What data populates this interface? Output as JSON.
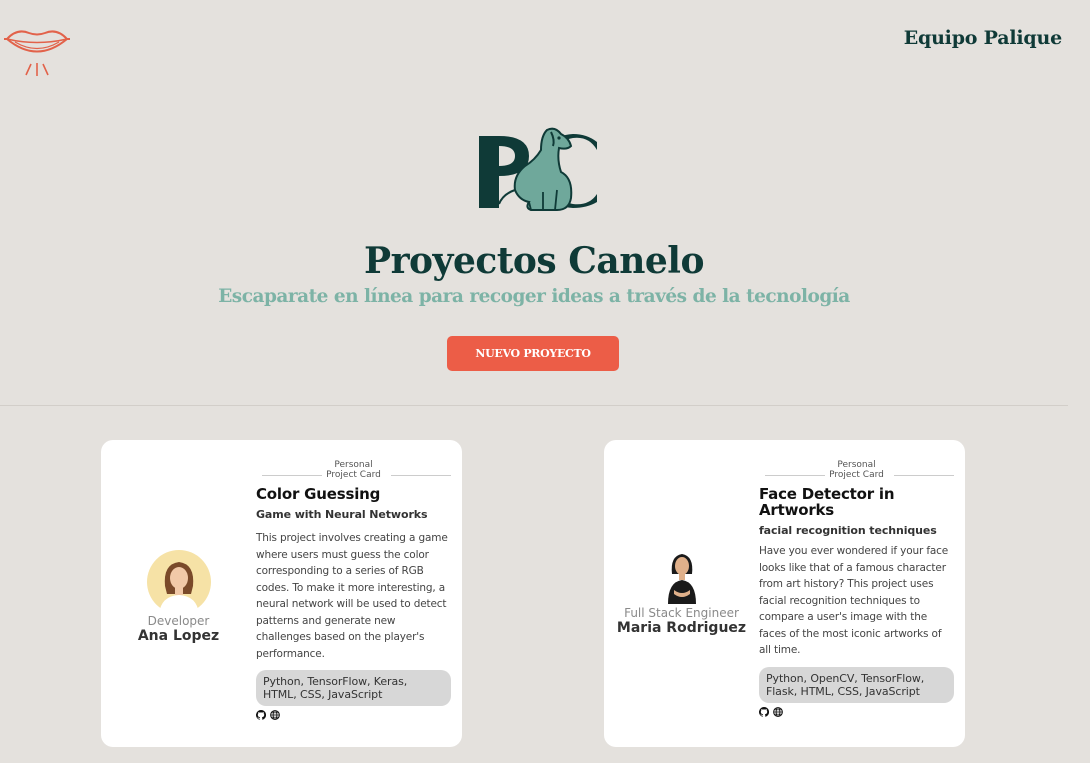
{
  "header": {
    "logo_icon": "lips-icon",
    "team_label": "Equipo Palique"
  },
  "hero": {
    "logo_icon": "pc-dog-logo",
    "title": "Proyectos Canelo",
    "subtitle": "Escaparate en línea para recoger ideas a través de la tecnología",
    "button_label": "NUEVO PROYECTO"
  },
  "colors": {
    "background": "#e4e1dd",
    "brand_dark": "#0f3a37",
    "brand_teal": "#7db3a6",
    "accent": "#ec5d47"
  },
  "cards": [
    {
      "card_label_line1": "Personal",
      "card_label_line2": "Project Card",
      "role": "Developer",
      "name": "Ana Lopez",
      "title": "Color Guessing",
      "subtitle": "Game with Neural Networks",
      "description": "This project involves creating a game where users must guess the color corresponding to a series of RGB codes. To make it more interesting, a neural network will be used to detect patterns and generate new challenges based on the player's performance.",
      "tags": "Python, TensorFlow, Keras, HTML, CSS, JavaScript",
      "link_icons": [
        "github-icon",
        "globe-icon"
      ]
    },
    {
      "card_label_line1": "Personal",
      "card_label_line2": "Project Card",
      "role": "Full Stack Engineer",
      "name": "Maria Rodriguez",
      "title": "Face Detector in Artworks",
      "subtitle": "facial recognition techniques",
      "description": "Have you ever wondered if your face looks like that of a famous character from art history? This project uses facial recognition techniques to compare a user's image with the faces of the most iconic artworks of all time.",
      "tags": "Python, OpenCV, TensorFlow, Flask, HTML, CSS, JavaScript",
      "link_icons": [
        "github-icon",
        "globe-icon"
      ]
    }
  ]
}
